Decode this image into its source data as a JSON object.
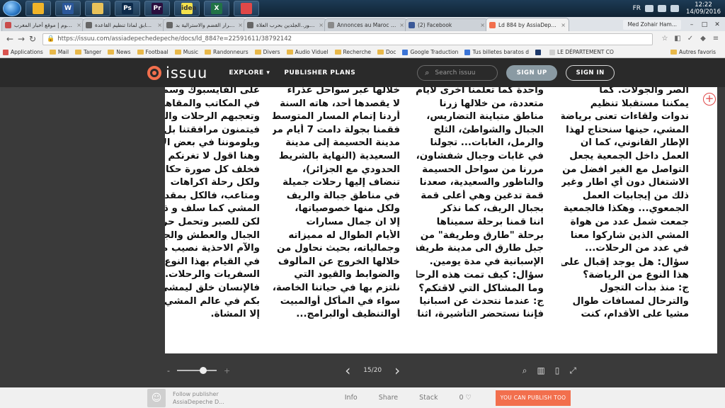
{
  "taskbar": {
    "apps": [
      {
        "icon": "chrome-icon",
        "label": "",
        "color": "#f0b429"
      },
      {
        "icon": "word-icon",
        "label": "W",
        "color": "#2b579a"
      },
      {
        "icon": "folder-icon",
        "label": "",
        "color": "#e8c25a"
      },
      {
        "icon": "photoshop-icon",
        "label": "Ps",
        "color": "#0c2a4a"
      },
      {
        "icon": "premiere-icon",
        "label": "Pr",
        "color": "#2a0f3e"
      },
      {
        "icon": "ideas-icon",
        "label": "idea",
        "color": "#f4e14c"
      },
      {
        "icon": "excel-icon",
        "label": "X",
        "color": "#217346"
      },
      {
        "icon": "chrome-active-icon",
        "label": "",
        "color": "#e04848"
      }
    ],
    "lang": "FR",
    "time": "12:22",
    "date": "14/09/2016"
  },
  "browser": {
    "tabs": [
      {
        "title": "ضرائب.كوم | موقع أخبار المغرب",
        "favicon": "#c94b4b",
        "active": false
      },
      {
        "title": "جهادي سابق لماذا تنظيم القاعدة...",
        "favicon": "#666666",
        "active": false
      },
      {
        "title": "هذا قرار القضم والاسترالية بد...",
        "favicon": "#666666",
        "active": false
      },
      {
        "title": "بالصور..الجلدين بحرب العلاة",
        "favicon": "#666666",
        "active": false
      },
      {
        "title": "Annonces au Maroc | Av",
        "favicon": "#8a8a8a",
        "active": false
      },
      {
        "title": "(2) Facebook",
        "favicon": "#3b5998",
        "active": false
      },
      {
        "title": "Ld 884 by AssiaDepeche",
        "favicon": "#f26f4d",
        "active": true
      }
    ],
    "profile": "Med Zohair Ham...",
    "url": "https://issuu.com/assiadepechedepeche/docs/ld_884?e=22591611/38792142",
    "bookmarks": [
      {
        "label": "Applications",
        "kind": "apps"
      },
      {
        "label": "Mail",
        "kind": "folder"
      },
      {
        "label": "Tanger",
        "kind": "folder"
      },
      {
        "label": "News",
        "kind": "folder"
      },
      {
        "label": "Footbaal",
        "kind": "folder"
      },
      {
        "label": "Music",
        "kind": "folder"
      },
      {
        "label": "Randonneurs",
        "kind": "folder"
      },
      {
        "label": "Divers",
        "kind": "folder"
      },
      {
        "label": "Audio Viduel",
        "kind": "folder"
      },
      {
        "label": "Recherche",
        "kind": "folder"
      },
      {
        "label": "Doc",
        "kind": "folder"
      },
      {
        "label": "Google Traduction",
        "kind": "google"
      },
      {
        "label": "Tus billetes baratos d",
        "kind": "go"
      },
      {
        "label": "",
        "kind": "dark"
      },
      {
        "label": "LE DÉPARTEMENT CO",
        "kind": "doc"
      }
    ],
    "other_bookmarks": "Autres favoris"
  },
  "issuu": {
    "logo": "issuu",
    "explore": "EXPLORE",
    "publisher_plans": "PUBLISHER PLANS",
    "search_placeholder": "Search issuu",
    "signup": "SIGN UP",
    "signin": "SIGN IN",
    "accent": "#f26f4d"
  },
  "article": {
    "col1": [
      {
        "text": "الصر والجولات. كما",
        "heading": false
      },
      {
        "text": "يمكننا مستقبلا تنظيم",
        "heading": false
      },
      {
        "text": "ندوات ولقاءات تعنى برياضة",
        "heading": false
      },
      {
        "text": "المشي، حينها سنحتاج لهذا",
        "heading": false
      },
      {
        "text": "الإطار القانوني، كما ان",
        "heading": false
      },
      {
        "text": "العمل داخل الجمعية يجعل",
        "heading": false
      },
      {
        "text": "التواصل مع الغير افضل من",
        "heading": false
      },
      {
        "text": "الاشتغال دون أي اطار وغير",
        "heading": false
      },
      {
        "text": "ذلك من إيجابيات العمل",
        "heading": false
      },
      {
        "text": "الجمعوي... وهكذا فالجمعية",
        "heading": false
      },
      {
        "text": "جمعت شمل عدد من هواة",
        "heading": false
      },
      {
        "text": "المشي الذين شاركوا معنا",
        "heading": false
      },
      {
        "text": "في عدد من الرحلات...",
        "heading": false
      },
      {
        "text": "سؤال: هل يوجد إقبال على",
        "heading": true
      },
      {
        "text": "هذا النوع من الرياضة؟",
        "heading": true
      },
      {
        "text": "ج: منذ بدأت التجول",
        "heading": false
      },
      {
        "text": "والترحال لمسافات طوال",
        "heading": false
      },
      {
        "text": "مشيا على الأقدام، كنت",
        "heading": false
      }
    ],
    "col2": [
      {
        "text": "واحدة كما تعلمنا اخرى لأيام",
        "heading": false
      },
      {
        "text": "متعددة، من خلالها زرنا",
        "heading": false
      },
      {
        "text": "مناطق متباينة التضاريس،",
        "heading": false
      },
      {
        "text": "الجبال والشواطئ، الثلج",
        "heading": false
      },
      {
        "text": "والرمل، الغابات... تجولنا",
        "heading": false
      },
      {
        "text": "في غابات وجبال شفشاون،",
        "heading": false
      },
      {
        "text": "مررنا من سواحل الحسيمة",
        "heading": false
      },
      {
        "text": "والناظور والسعيدية، صعدنا",
        "heading": false
      },
      {
        "text": "قمة تدغين وهي أعلى قمة",
        "heading": false
      },
      {
        "text": "بجبال الريف، كما نذكر",
        "heading": false
      },
      {
        "text": "اننا قمنا برحلة سميناها",
        "heading": false
      },
      {
        "text": "برحلة \"طارق وطريفة\" من",
        "heading": false
      },
      {
        "text": "جبل طارق الى مدينة طريفة",
        "heading": false
      },
      {
        "text": "الإسبانية في مدة يومين.",
        "heading": false
      },
      {
        "text": "سؤال: كيف تمت هذه الرحلة؟",
        "heading": true
      },
      {
        "text": "وما المشاكل التي لاقتكم؟",
        "heading": true
      },
      {
        "text": "ج: عندما نتحدث عن اسبانيا",
        "heading": false
      },
      {
        "text": "فإننا نستحضر التأشيرة، اثناء",
        "heading": false
      }
    ],
    "col3": [
      {
        "text": "خلالها عبر سواحل عذراء",
        "heading": false
      },
      {
        "text": "لا يقصدها أحد، هاته السنة",
        "heading": false
      },
      {
        "text": "أردنا إتمام المسار المتوسطي",
        "heading": false
      },
      {
        "text": "فقمنا بجولة دامت 7 أيام من",
        "heading": false
      },
      {
        "text": "مدينة الحسيمة إلى مدينة",
        "heading": false
      },
      {
        "text": "السعيدية (النهاية بالشريط",
        "heading": false
      },
      {
        "text": "الحدودي مع الجزائر)،",
        "heading": false
      },
      {
        "text": "تنضاف إليها رحلات جميلة",
        "heading": false
      },
      {
        "text": "في مناطق جبالة والريف",
        "heading": false
      },
      {
        "text": "ولكل منها خصوصياتها،",
        "heading": false
      },
      {
        "text": "إلا ان جمال مسارات",
        "heading": false
      },
      {
        "text": "الأيام الطوال له مميزاته",
        "heading": false
      },
      {
        "text": "وجمالياته، بحيث نحاول من",
        "heading": false
      },
      {
        "text": "خلالها الخروج عن المألوف",
        "heading": false
      },
      {
        "text": "والضوابط والقيود التي",
        "heading": false
      },
      {
        "text": "نلتزم بها في حياتنا الخاصة،",
        "heading": false
      },
      {
        "text": "سواء في المأكل أوالمبيت",
        "heading": false
      },
      {
        "text": "أوالتنظيف أوالبرامج...",
        "heading": false
      }
    ],
    "col4": [
      {
        "text": "على الفايسبوك وسم لعود",
        "heading": false
      },
      {
        "text": "في المكاتب والمقاهي...",
        "heading": false
      },
      {
        "text": "وتعجبهم الرحلات والمناظر",
        "heading": false
      },
      {
        "text": "فيتمنون مرافقتنا بل",
        "heading": false
      },
      {
        "text": "ويلوموننا في بعض الاحيان،",
        "heading": false
      },
      {
        "text": "وهنا اقول لا تغرنكم الصور",
        "heading": false
      },
      {
        "text": "فخلف كل صورة حكايات،",
        "heading": false
      },
      {
        "text": "ولكل رحلة اكراهات",
        "heading": false
      },
      {
        "text": "ومتاعب، فالكل بمقدوره",
        "heading": false
      },
      {
        "text": "المشي كما سلف و ذكرت،",
        "heading": false
      },
      {
        "text": "لكن للصبر وتحمل حرارة",
        "heading": false
      },
      {
        "text": "الجبال والعطش والجوع",
        "heading": false
      },
      {
        "text": "والآم الاحذية نصيب مهم",
        "heading": false
      },
      {
        "text": "في القيام بهذا النوع من",
        "heading": false
      },
      {
        "text": "السفريات والرحلات...",
        "heading": false
      },
      {
        "text": "فالإنسان خلق ليمشي. مرحبا",
        "heading": false
      },
      {
        "text": "بكم في عالم المشي وما فاز",
        "heading": false
      },
      {
        "text": "إلا المشاة.",
        "heading": false
      }
    ]
  },
  "viewer": {
    "zoom_minus": "-",
    "zoom_plus": "+",
    "zoom_level": 0.7,
    "page_indicator": "15/20"
  },
  "footer": {
    "follow_label": "Follow publisher",
    "publisher": "AssiaDepeche D...",
    "info": "Info",
    "share": "Share",
    "stack": "Stack",
    "likes": "0",
    "publish": "YOU CAN PUBLISH TOO"
  }
}
